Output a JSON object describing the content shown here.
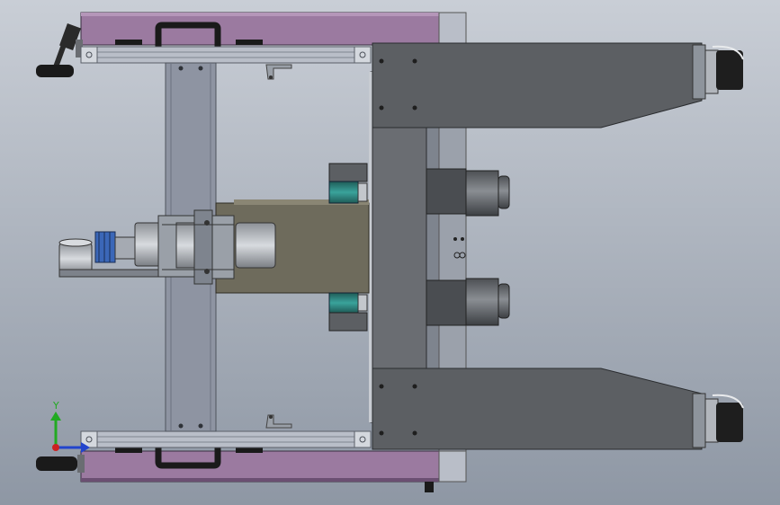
{
  "viewport": {
    "background_top": "#c9ced6",
    "background_bottom": "#8e97a4"
  },
  "colors": {
    "frame_purple": "#9b7aa0",
    "frame_purple_dark": "#6b4f72",
    "aluminum": "#b9bec8",
    "aluminum_dark": "#7f8591",
    "steel_gray": "#5c5f63",
    "steel_dark": "#3f4246",
    "plate_olive": "#6e6b5c",
    "teal": "#2f7f7a",
    "black": "#1a1a1a",
    "blue_part": "#3b67b8"
  },
  "triad": {
    "y_label": "Y",
    "y_color": "#22aa22",
    "x_color": "#2244cc",
    "z_color": "#cc2222"
  }
}
